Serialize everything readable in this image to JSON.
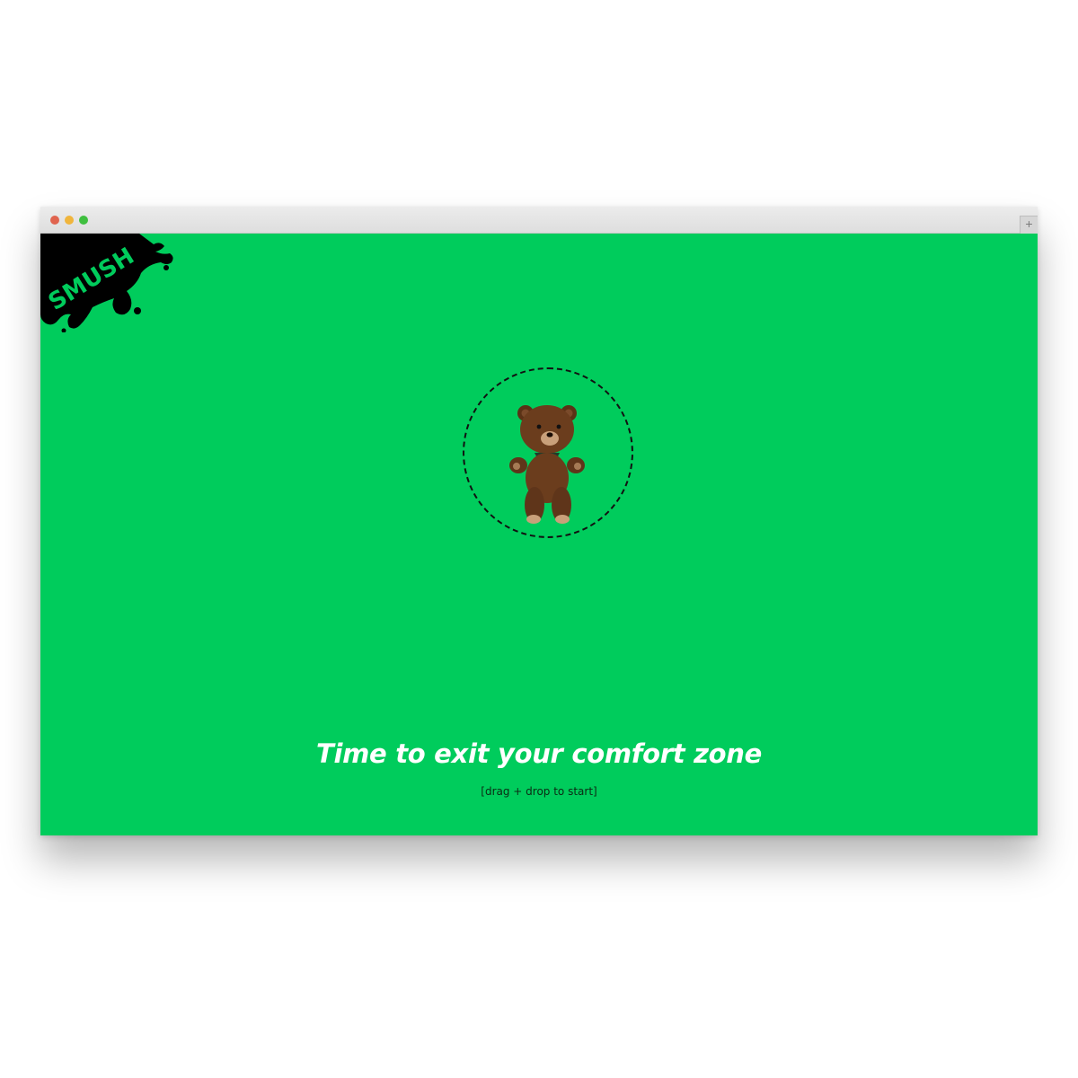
{
  "window": {
    "traffic_lights": {
      "close_color": "#e0644f",
      "minimize_color": "#f0b53c",
      "maximize_color": "#3fbf3f"
    },
    "new_tab_label": "+"
  },
  "page": {
    "background_color": "#00cc5c",
    "logo_text": "SMUSH",
    "headline": "Time to exit your comfort zone",
    "hint": "[drag + drop to start]"
  }
}
